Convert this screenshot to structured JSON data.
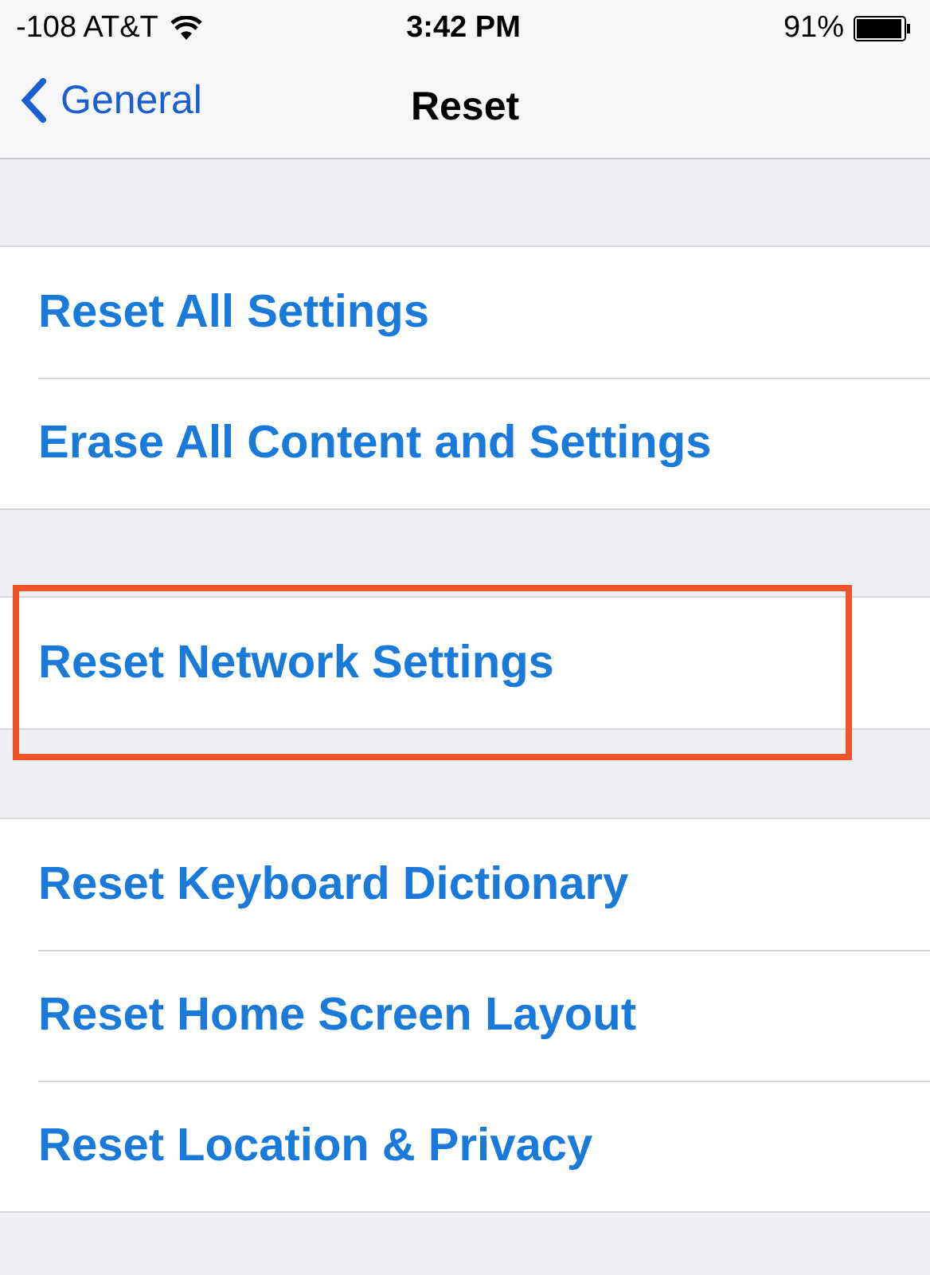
{
  "status_bar": {
    "carrier": "-108 AT&T",
    "time": "3:42 PM",
    "battery": "91%"
  },
  "nav_bar": {
    "back": "General",
    "title": "Reset"
  },
  "groups": [
    {
      "items": [
        {
          "label": "Reset All Settings",
          "highlighted": false
        },
        {
          "label": "Erase All Content and Settings",
          "highlighted": false
        }
      ]
    },
    {
      "items": [
        {
          "label": "Reset Network Settings",
          "highlighted": true
        }
      ]
    },
    {
      "items": [
        {
          "label": "Reset Keyboard Dictionary",
          "highlighted": false
        },
        {
          "label": "Reset Home Screen Layout",
          "highlighted": false
        },
        {
          "label": "Reset Location & Privacy",
          "highlighted": false
        }
      ]
    }
  ]
}
